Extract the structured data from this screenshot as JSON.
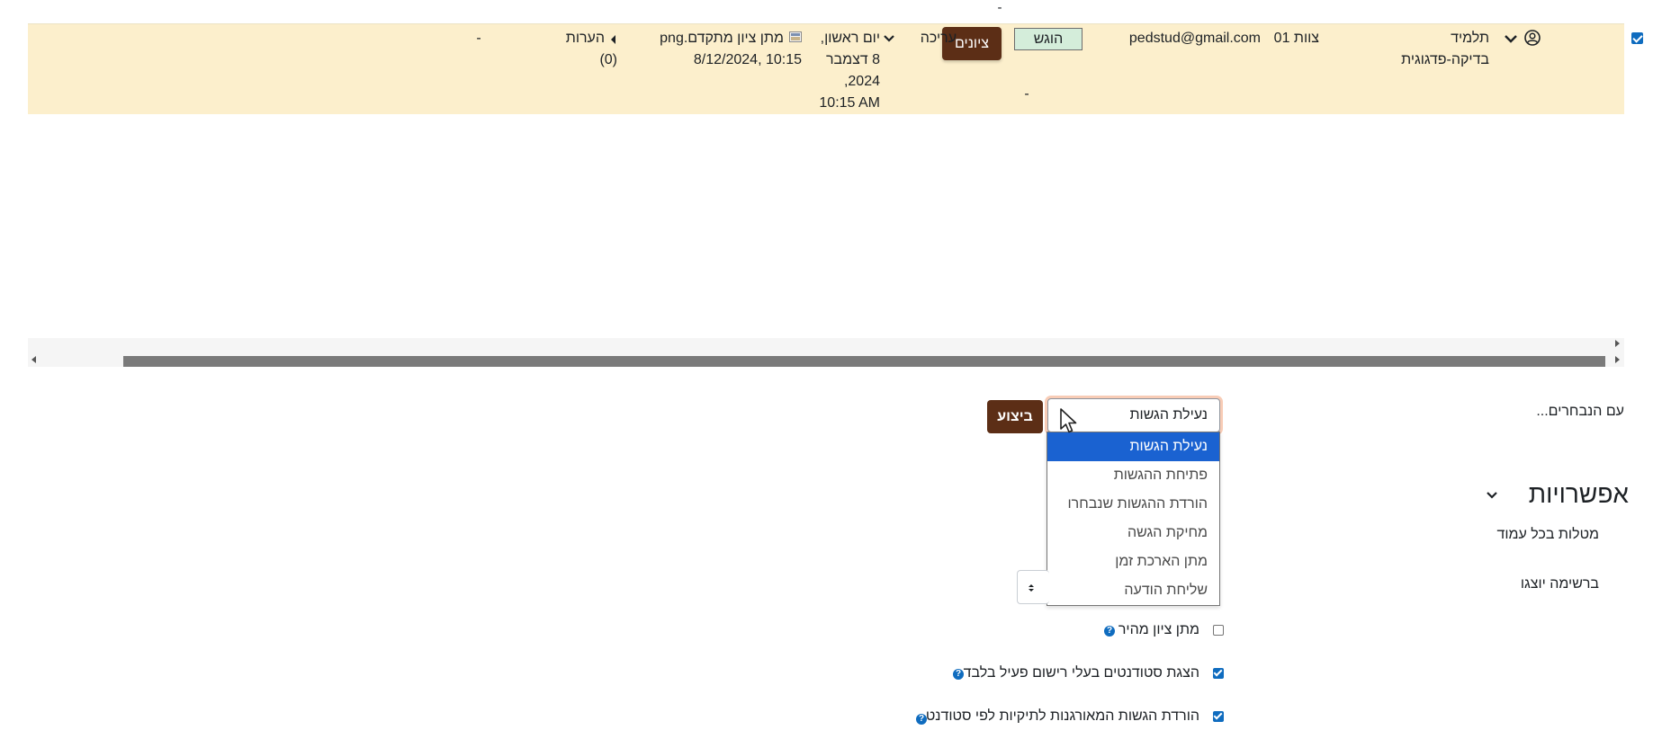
{
  "colors": {
    "row_highlight": "#fcefcc",
    "primary_button": "#5c2e16",
    "status_badge": "#d4edda",
    "selected_option": "#1a62d1",
    "checkbox": "#0f6cbf",
    "select_focus": "#f2a27a"
  },
  "top_dash": "-",
  "row": {
    "selected": true,
    "user_icon": "user-circle-icon",
    "name_line1": "תלמיד",
    "name_line2": "בדיקה-פדגוגית",
    "team": "צוות 01",
    "email": "pedstud@gmail.com",
    "status": "הוגש",
    "grade_button": "ציונים",
    "grade_value": "-",
    "edit_label": "עריכה",
    "date_line1": "יום ראשון,",
    "date_line2": "8 דצמבר",
    "date_line3": "2024,",
    "date_line4": "10:15 AM",
    "file_name": "מתן ציון מתקדם.png",
    "file_time": "8/12/2024, 10:15",
    "comments_label": "הערות",
    "comments_count": "(0)",
    "last_value": "-"
  },
  "bulk_actions": {
    "label": "עם הנבחרים...",
    "selected_value": "נעילת הגשות",
    "go_button": "ביצוע",
    "options": [
      "נעילת הגשות",
      "פתיחת ההגשות",
      "הורדת ההגשות שנבחרו",
      "מחיקת הגשה",
      "מתן הארכת זמן",
      "שליחת הודעה"
    ]
  },
  "options_section": {
    "heading": "אפשרויות",
    "per_page_label": "מטלות בכל עמוד",
    "show_in_list_label": "ברשימה יוצגו",
    "quick_grading": {
      "label": "מתן ציון מהיר",
      "checked": false
    },
    "active_only": {
      "label": "הצגת סטודנטים בעלי רישום פעיל בלבד",
      "checked": true
    },
    "download_folders": {
      "label": "הורדת הגשות המאורגנות לתיקיות לפי סטודנט",
      "checked": true
    }
  }
}
